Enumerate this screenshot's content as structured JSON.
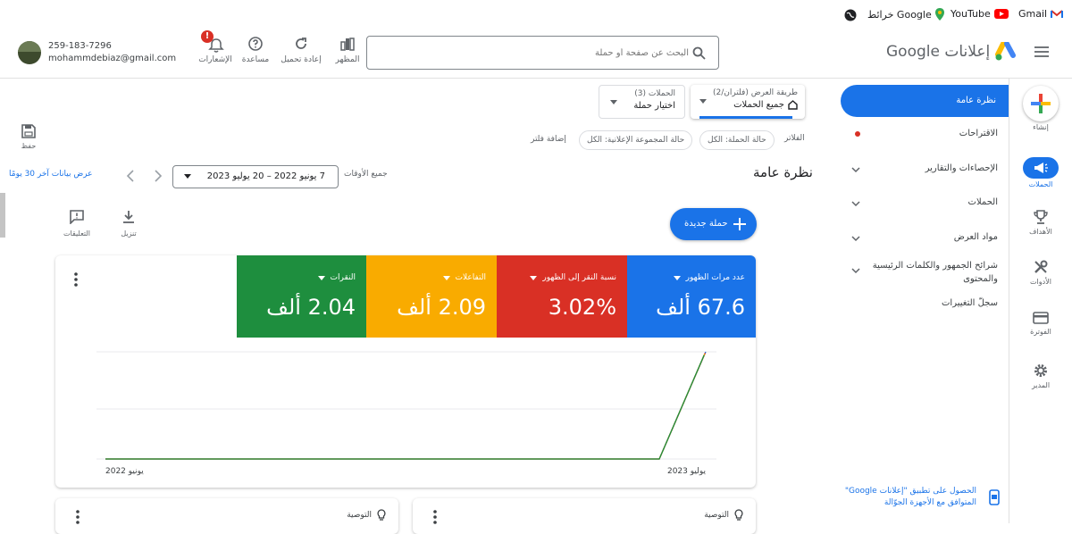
{
  "bookmarks": {
    "gmail": "Gmail",
    "youtube": "YouTube",
    "maps": "خرائط Google"
  },
  "account": {
    "phone": "259-183-7296",
    "email": "mohammdebiaz@gmail.com"
  },
  "header": {
    "notifications_label": "الإشعارات",
    "help_label": "مساعدة",
    "refresh_label": "إعادة تحميل",
    "appearance_label": "المظهر",
    "search_placeholder": "البحث عن صفحة أو حملة",
    "app_title": "إعلانات Google"
  },
  "rail": {
    "create": "إنشاء",
    "campaigns": "الحملات",
    "goals": "الأهداف",
    "tools": "الأدوات",
    "billing": "الفوترة",
    "admin": "المدير"
  },
  "nav": {
    "overview": "نظرة عامة",
    "recommendations": "الاقتراحات",
    "insights": "الإحصاءات والتقارير",
    "campaigns": "الحملات",
    "assets": "مواد العرض",
    "audiences": "شرائح الجمهور والكلمات الرئيسية والمحتوى",
    "change_history": "سجلّ التغييرات",
    "mobile_app": "الحصول على تطبيق \"إعلانات Google\" المتوافق مع الأجهزة الجوّالة"
  },
  "view_selector": {
    "label": "طريقة العرض (فلتران/2)",
    "value": "جميع الحملات"
  },
  "campaign_selector": {
    "label": "الحملات (3)",
    "value": "اختيار حملة"
  },
  "toolbar": {
    "save": "حفظ",
    "download": "تنزيل",
    "feedback": "التعليقات"
  },
  "filters": {
    "label": "الفلاتر",
    "campaign_status": "حالة الحملة: الكل",
    "adgroup_status": "حالة المجموعة الإعلانية: الكل",
    "add_filter": "إضافة فلتر"
  },
  "date": {
    "title": "نظرة عامة",
    "range_label": "جميع الأوقات",
    "range_value": "7 يونيو 2022 – 20 يوليو 2023",
    "last30": "عرض بيانات آخر 30 يومًا"
  },
  "new_campaign": "حملة جديدة",
  "metrics": [
    {
      "label": "عدد مرات الظهور",
      "value": "67.6 ألف",
      "color": "#1a73e8"
    },
    {
      "label": "نسبة النقر إلى الظهور",
      "value": "3.02%",
      "color": "#d93025"
    },
    {
      "label": "التفاعلات",
      "value": "2.09 ألف",
      "color": "#f9ab00"
    },
    {
      "label": "النقرات",
      "value": "2.04 ألف",
      "color": "#1e8e3e"
    }
  ],
  "chart_data": {
    "type": "line",
    "x": [
      "يونيو 2022",
      "يوليو 2023"
    ],
    "series": [
      {
        "color": "#1a73e8"
      },
      {
        "color": "#d93025"
      },
      {
        "color": "#f9ab00"
      },
      {
        "color": "#1e8e3e"
      }
    ],
    "xtick_labels": [
      "يونيو 2022",
      "يوليو 2023"
    ]
  },
  "recommendation": "التوصية"
}
